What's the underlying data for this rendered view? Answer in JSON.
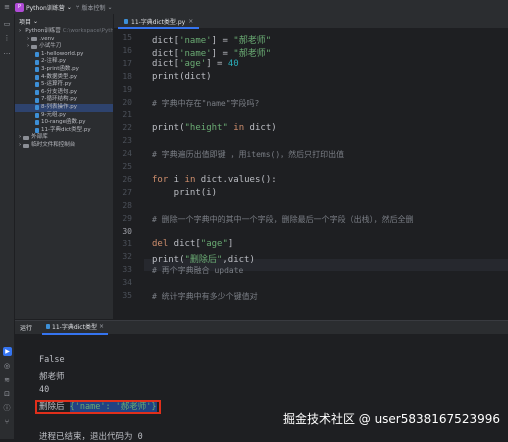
{
  "titlebar": {
    "project_badge": "P",
    "project_name": "Python训练营",
    "version_control": "版本控制"
  },
  "project_panel": {
    "header": "项目",
    "tree": [
      {
        "label": "Python训练营",
        "suffix": "C:\\workspace\\Pyth",
        "type": "folder",
        "indent": 0
      },
      {
        "label": ".venv",
        "type": "folder",
        "indent": 1
      },
      {
        "label": "小试牛刀",
        "type": "folder",
        "indent": 1
      },
      {
        "label": "1-helloworld.py",
        "type": "file",
        "indent": 2
      },
      {
        "label": "2-注释.py",
        "type": "file",
        "indent": 2
      },
      {
        "label": "3-print函数.py",
        "type": "file",
        "indent": 2
      },
      {
        "label": "4-数据类型.py",
        "type": "file",
        "indent": 2
      },
      {
        "label": "5-运算符.py",
        "type": "file",
        "indent": 2
      },
      {
        "label": "6-分支语句.py",
        "type": "file",
        "indent": 2
      },
      {
        "label": "7-循环结构.py",
        "type": "file",
        "indent": 2
      },
      {
        "label": "8-列表操作.py",
        "type": "file",
        "indent": 2,
        "selected": true
      },
      {
        "label": "9-元组.py",
        "type": "file",
        "indent": 2
      },
      {
        "label": "10-range函数.py",
        "type": "file",
        "indent": 2
      },
      {
        "label": "11-字典dict类型.py",
        "type": "file",
        "indent": 2
      },
      {
        "label": "外部库",
        "type": "folder",
        "indent": 0
      },
      {
        "label": "临时文件和控制台",
        "type": "folder",
        "indent": 0
      }
    ]
  },
  "editor": {
    "tab_label": "11-字典dict类型.py",
    "current_line": "30",
    "lines": [
      {
        "n": "15",
        "text": "dict['name'] = \"郝老师\""
      },
      {
        "n": "16",
        "text": "dict['name'] = \"郝老师\""
      },
      {
        "n": "17",
        "text": "dict['age'] = 40"
      },
      {
        "n": "18",
        "text": "print(dict)"
      },
      {
        "n": "19",
        "text": ""
      },
      {
        "n": "20",
        "text": "# 字典中存在\"name\"字段吗?"
      },
      {
        "n": "21",
        "text": ""
      },
      {
        "n": "22",
        "text": "print(\"height\" in dict)"
      },
      {
        "n": "23",
        "text": ""
      },
      {
        "n": "24",
        "text": "# 字典遍历出值即键 ，用items()，然后只打印出值"
      },
      {
        "n": "25",
        "text": ""
      },
      {
        "n": "26",
        "text": "for i in dict.values():"
      },
      {
        "n": "27",
        "text": "    print(i)"
      },
      {
        "n": "28",
        "text": ""
      },
      {
        "n": "29",
        "text": "# 删除一个字典中的其中一个字段，删除最后一个字段（出栈），然后全删"
      },
      {
        "n": "30",
        "text": ""
      },
      {
        "n": "31",
        "text": "del dict[\"age\"]"
      },
      {
        "n": "32",
        "text": "print(\"删除后\",dict)"
      },
      {
        "n": "33",
        "text": "# 再个字典融合 update"
      },
      {
        "n": "34",
        "text": ""
      },
      {
        "n": "35",
        "text": "# 统计字典中有多少个键值对"
      }
    ]
  },
  "run_panel": {
    "title": "运行",
    "tab_label": "11-字典dict类型",
    "output": [
      "False",
      "郝老师",
      "40",
      "删除后 {'name': '郝老师'}",
      "",
      "进程已结束，退出代码为 0"
    ],
    "highlight_prefix": "删除后 ",
    "highlight_value": "{'name': '郝老师'}"
  },
  "watermark": "掘金技术社区 @ user5838167523996",
  "colors": {
    "accent": "#3574f0",
    "highlight_box": "#e02f1b",
    "string": "#6aab73",
    "number": "#2aacb8",
    "keyword": "#cf8e6d",
    "comment": "#7a7e85"
  }
}
